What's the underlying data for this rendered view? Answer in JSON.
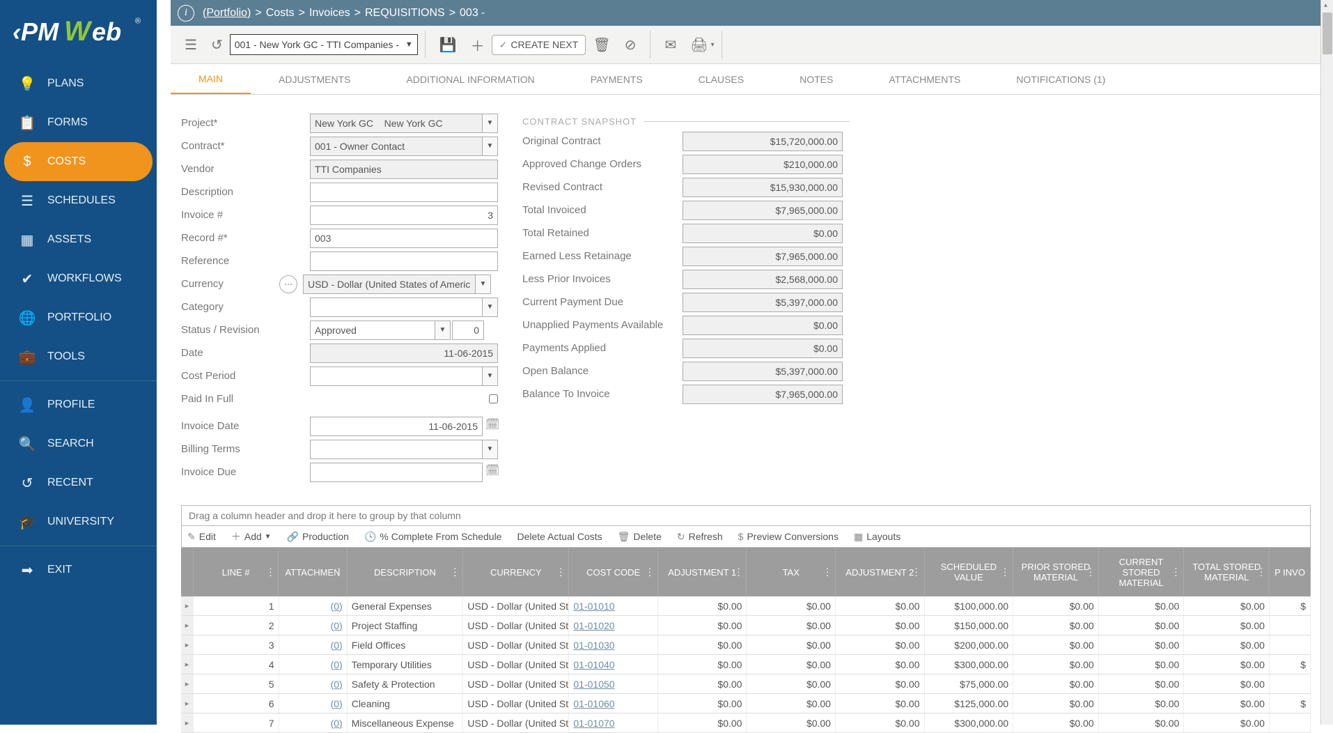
{
  "breadcrumb": {
    "portfolio": "(Portfolio)",
    "sep": ">",
    "costs": "Costs",
    "invoices": "Invoices",
    "req": "REQUISITIONS",
    "num": "003",
    "dash": "-"
  },
  "toolbar": {
    "combo": "001 - New York GC - TTI Companies -",
    "create": "CREATE NEXT"
  },
  "tabs": [
    "MAIN",
    "ADJUSTMENTS",
    "ADDITIONAL INFORMATION",
    "PAYMENTS",
    "CLAUSES",
    "NOTES",
    "ATTACHMENTS",
    "NOTIFICATIONS (1)"
  ],
  "sidebar": [
    "PLANS",
    "FORMS",
    "COSTS",
    "SCHEDULES",
    "ASSETS",
    "WORKFLOWS",
    "PORTFOLIO",
    "TOOLS",
    "PROFILE",
    "SEARCH",
    "RECENT",
    "UNIVERSITY",
    "EXIT"
  ],
  "form": {
    "project_label": "Project*",
    "project_value": "New York GC    New York GC",
    "contract_label": "Contract*",
    "contract_value": "001 - Owner Contact",
    "vendor_label": "Vendor",
    "vendor_value": "TTI Companies",
    "desc_label": "Description",
    "desc_value": "",
    "invoiceno_label": "Invoice #",
    "invoiceno_value": "3",
    "recordno_label": "Record #*",
    "recordno_value": "003",
    "ref_label": "Reference",
    "ref_value": "",
    "currency_label": "Currency",
    "currency_value": "USD - Dollar (United States of America)",
    "category_label": "Category",
    "category_value": "",
    "status_label": "Status / Revision",
    "status_value": "Approved",
    "status_rev": "0",
    "date_label": "Date",
    "date_value": "11-06-2015",
    "costperiod_label": "Cost Period",
    "costperiod_value": "",
    "paidfull_label": "Paid In Full",
    "invdate_label": "Invoice Date",
    "invdate_value": "11-06-2015",
    "billing_label": "Billing Terms",
    "billing_value": "",
    "invdue_label": "Invoice Due",
    "invdue_value": ""
  },
  "snapshot": {
    "title": "CONTRACT SNAPSHOT",
    "rows": [
      {
        "l": "Original Contract",
        "v": "$15,720,000.00"
      },
      {
        "l": "Approved Change Orders",
        "v": "$210,000.00"
      },
      {
        "l": "Revised Contract",
        "v": "$15,930,000.00"
      },
      {
        "l": "Total Invoiced",
        "v": "$7,965,000.00"
      },
      {
        "l": "Total Retained",
        "v": "$0.00"
      },
      {
        "l": "Earned Less Retainage",
        "v": "$7,965,000.00"
      },
      {
        "l": "Less Prior Invoices",
        "v": "$2,568,000.00"
      },
      {
        "l": "Current Payment Due",
        "v": "$5,397,000.00"
      },
      {
        "l": "Unapplied Payments Available",
        "v": "$0.00"
      },
      {
        "l": "Payments Applied",
        "v": "$0.00"
      },
      {
        "l": "Open Balance",
        "v": "$5,397,000.00"
      },
      {
        "l": "Balance To Invoice",
        "v": "$7,965,000.00"
      }
    ]
  },
  "grid": {
    "group_bar": "Drag a column header and drop it here to group by that column",
    "tb": {
      "edit": "Edit",
      "add": "Add",
      "production": "Production",
      "pct": "% Complete From Schedule",
      "del_actual": "Delete Actual Costs",
      "delete": "Delete",
      "refresh": "Refresh",
      "preview": "Preview Conversions",
      "layouts": "Layouts"
    },
    "headers": [
      "LINE #",
      "ATTACHMEN",
      "DESCRIPTION",
      "CURRENCY",
      "COST CODE",
      "ADJUSTMENT 1",
      "TAX",
      "ADJUSTMENT 2",
      "SCHEDULED VALUE",
      "PRIOR STORED MATERIAL",
      "CURRENT STORED MATERIAL",
      "TOTAL STORED MATERIAL",
      "P INVO"
    ],
    "rows": [
      {
        "n": "1",
        "a": "(0)",
        "d": "General Expenses",
        "cur": "USD - Dollar (United Sta",
        "cc": "01-01010",
        "a1": "$0.00",
        "tax": "$0.00",
        "a2": "$0.00",
        "sv": "$100,000.00",
        "ps": "$0.00",
        "cs": "$0.00",
        "ts": "$0.00",
        "p": "$"
      },
      {
        "n": "2",
        "a": "(0)",
        "d": "Project Staffing",
        "cur": "USD - Dollar (United Sta",
        "cc": "01-01020",
        "a1": "$0.00",
        "tax": "$0.00",
        "a2": "$0.00",
        "sv": "$150,000.00",
        "ps": "$0.00",
        "cs": "$0.00",
        "ts": "$0.00",
        "p": ""
      },
      {
        "n": "3",
        "a": "(0)",
        "d": "Field Offices",
        "cur": "USD - Dollar (United Sta",
        "cc": "01-01030",
        "a1": "$0.00",
        "tax": "$0.00",
        "a2": "$0.00",
        "sv": "$200,000.00",
        "ps": "$0.00",
        "cs": "$0.00",
        "ts": "$0.00",
        "p": ""
      },
      {
        "n": "4",
        "a": "(0)",
        "d": "Temporary Utilities",
        "cur": "USD - Dollar (United Sta",
        "cc": "01-01040",
        "a1": "$0.00",
        "tax": "$0.00",
        "a2": "$0.00",
        "sv": "$300,000.00",
        "ps": "$0.00",
        "cs": "$0.00",
        "ts": "$0.00",
        "p": "$"
      },
      {
        "n": "5",
        "a": "(0)",
        "d": "Safety & Protection",
        "cur": "USD - Dollar (United Sta",
        "cc": "01-01050",
        "a1": "$0.00",
        "tax": "$0.00",
        "a2": "$0.00",
        "sv": "$75,000.00",
        "ps": "$0.00",
        "cs": "$0.00",
        "ts": "$0.00",
        "p": ""
      },
      {
        "n": "6",
        "a": "(0)",
        "d": "Cleaning",
        "cur": "USD - Dollar (United Sta",
        "cc": "01-01060",
        "a1": "$0.00",
        "tax": "$0.00",
        "a2": "$0.00",
        "sv": "$125,000.00",
        "ps": "$0.00",
        "cs": "$0.00",
        "ts": "$0.00",
        "p": "$"
      },
      {
        "n": "7",
        "a": "(0)",
        "d": "Miscellaneous Expense",
        "cur": "USD - Dollar (United Sta",
        "cc": "01-01070",
        "a1": "$0.00",
        "tax": "$0.00",
        "a2": "$0.00",
        "sv": "$300,000.00",
        "ps": "$0.00",
        "cs": "$0.00",
        "ts": "$0.00",
        "p": ""
      }
    ]
  }
}
